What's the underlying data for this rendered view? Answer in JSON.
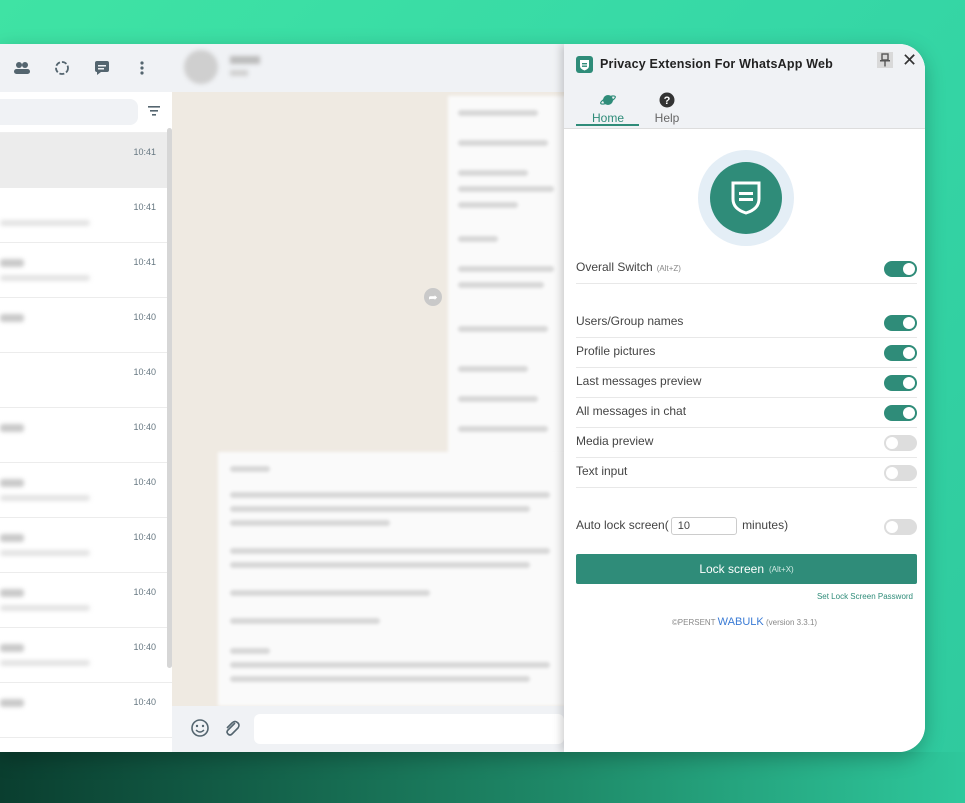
{
  "chatlist": {
    "times": [
      "10:41",
      "10:41",
      "10:41",
      "10:40",
      "10:40",
      "10:40",
      "10:40",
      "10:40",
      "10:40",
      "10:40",
      "10:40"
    ]
  },
  "extension": {
    "title": "Privacy Extension For WhatsApp Web",
    "tabs": [
      {
        "label": "Home",
        "active": true
      },
      {
        "label": "Help",
        "active": false
      }
    ],
    "overall_switch": {
      "label": "Overall Switch",
      "shortcut": "(Alt+Z)",
      "on": true
    },
    "options": [
      {
        "label": "Users/Group names",
        "on": true
      },
      {
        "label": "Profile pictures",
        "on": true
      },
      {
        "label": "Last messages preview",
        "on": true
      },
      {
        "label": "All messages in chat",
        "on": true
      },
      {
        "label": "Media preview",
        "on": false
      },
      {
        "label": "Text input",
        "on": false
      }
    ],
    "auto_lock": {
      "prefix": "Auto lock screen(",
      "value": "10",
      "suffix": "minutes)",
      "on": false
    },
    "lock_button": {
      "label": "Lock screen",
      "shortcut": "(Alt+X)"
    },
    "set_password_link": "Set Lock Screen Password",
    "footer": {
      "company": "©PERSENT",
      "brand": "WABULK",
      "version": "(version 3.3.1)"
    }
  },
  "colors": {
    "accent": "#2f8c79",
    "brand_link": "#3a7bd5",
    "toggle_off": "#dddddd"
  }
}
